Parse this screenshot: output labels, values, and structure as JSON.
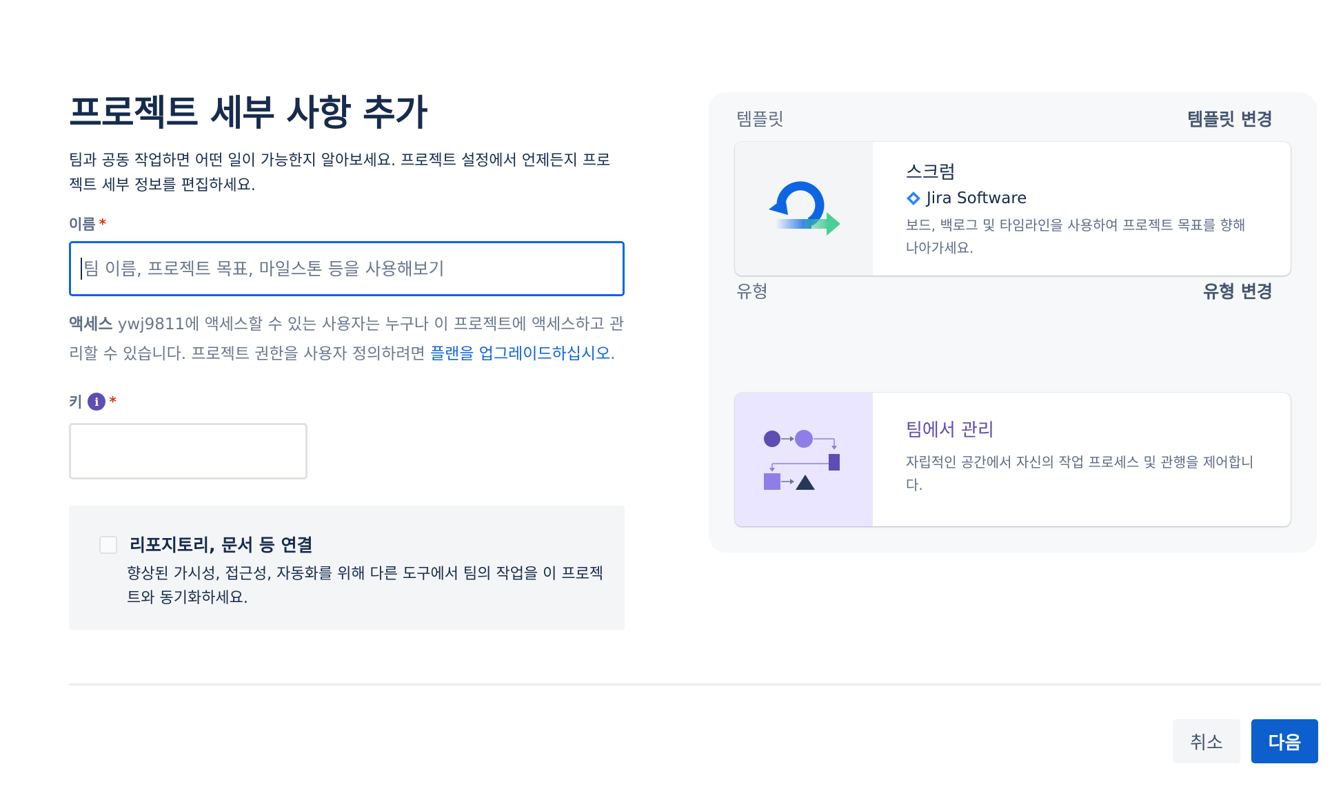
{
  "page": {
    "title": "프로젝트 세부 사항 추가",
    "subtitle": "팀과 공동 작업하면 어떤 일이 가능한지 알아보세요. 프로젝트 설정에서 언제든지 프로젝트 세부 정보를 편집하세요."
  },
  "name_field": {
    "label": "이름",
    "required_mark": "*",
    "value": "",
    "placeholder": "팀 이름, 프로젝트 목표, 마일스톤 등을 사용해보기"
  },
  "access": {
    "prefix_bold": "액세스",
    "text": " ywj9811에 액세스할 수 있는 사용자는 누구나 이 프로젝트에 액세스하고 관리할 수 있습니다. 프로젝트 권한을 사용자 정의하려면 ",
    "link": "플랜을 업그레이드하십시오",
    "suffix": "."
  },
  "key_field": {
    "label": "키",
    "info_icon": "info-icon",
    "info_glyph": "i",
    "required_mark": "*",
    "value": ""
  },
  "connect": {
    "title": "리포지토리, 문서 등 연결",
    "description": "향상된 가시성, 접근성, 자동화를 위해 다른 도구에서 팀의 작업을 이 프로젝트와 동기화하세요.",
    "checked": false
  },
  "template": {
    "section_label": "템플릿",
    "change_link": "템플릿 변경",
    "card_title": "스크럼",
    "product": "Jira Software",
    "description": "보드, 백로그 및 타임라인을 사용하여 프로젝트 목표를 향해 나아가세요.",
    "thumb_bg": "#f4f5f7"
  },
  "type": {
    "section_label": "유형",
    "change_link": "유형 변경",
    "card_title": "팀에서 관리",
    "description": "자립적인 공간에서 자신의 작업 프로세스 및 관행을 제어합니다.",
    "thumb_bg": "#eae6ff",
    "title_color": "#5e4db2"
  },
  "footer": {
    "cancel_label": "취소",
    "next_label": "다음"
  },
  "colors": {
    "primary": "#0c5fcd",
    "focus_border": "#0c66e4",
    "link": "#0c66e4",
    "purple": "#5e4db2",
    "required": "#de350b"
  }
}
